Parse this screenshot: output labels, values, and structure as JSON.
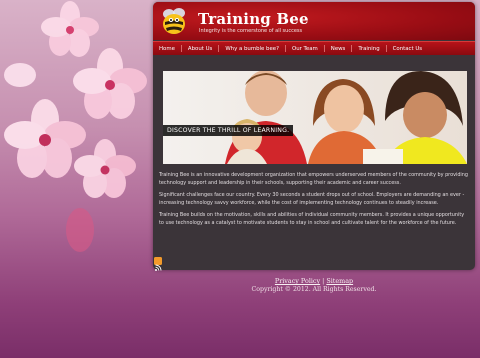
{
  "header": {
    "title": "Training Bee",
    "tagline": "Integrity is the cornerstone of all success"
  },
  "nav": {
    "items": [
      {
        "label": "Home"
      },
      {
        "label": "About Us"
      },
      {
        "label": "Why a bumble bee?"
      },
      {
        "label": "Our Team"
      },
      {
        "label": "News"
      },
      {
        "label": "Training"
      },
      {
        "label": "Contact Us"
      }
    ]
  },
  "hero": {
    "caption": "DISCOVER THE THRILL OF LEARNING."
  },
  "content": {
    "paragraphs": [
      "Training Bee is an innovative development organization that empowers underserved members of the community by providing technology support and leadership in their schools, supporting their academic and career success.",
      "Significant challenges face our country. Every 30 seconds a student drops out of school. Employers are demanding an ever -increasing technology savvy workforce, while the cost of implementing technology continues to steadily increase.",
      "Training Bee builds on the motivation, skills and abilities of individual community members. It provides a unique opportunity to use technology as a catalyst to motivate students to stay in school and cultivate talent for the workforce of the future."
    ]
  },
  "footer": {
    "privacy_label": "Privacy Policy",
    "separator": "|",
    "sitemap_label": "Sitemap",
    "copyright": "Copyright © 2012. All Rights Reserved."
  },
  "icons": {
    "logo": "bee-icon",
    "feed": "rss-icon"
  },
  "colors": {
    "header_red": "#9a0d14",
    "nav_red": "#b71219",
    "panel": "#3b3439",
    "rss": "#f39a2b"
  }
}
